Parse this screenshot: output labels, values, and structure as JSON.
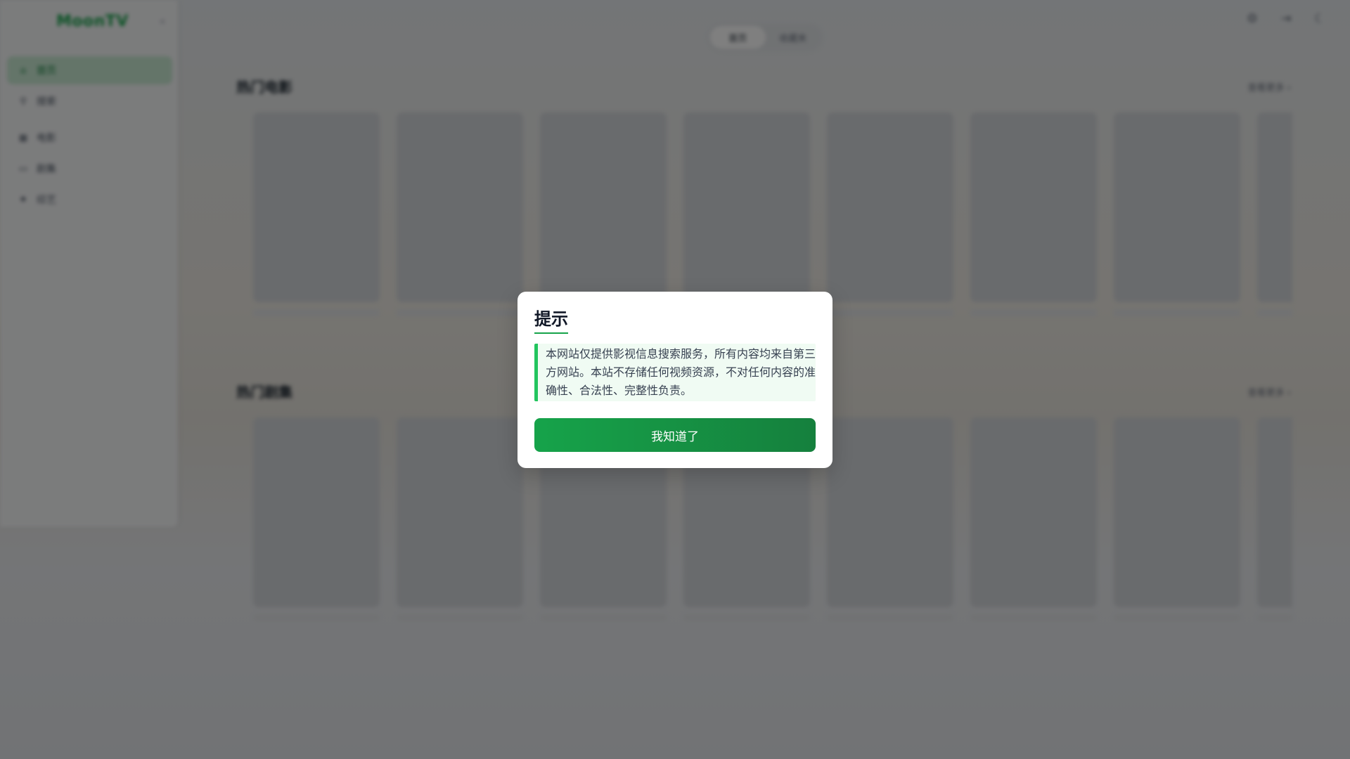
{
  "app": {
    "logo": "MoonTV",
    "collapse_icon": "collapse-icon"
  },
  "sidebar": {
    "items": [
      {
        "label": "首页",
        "icon": "home-icon",
        "active": true
      },
      {
        "label": "搜索",
        "icon": "search-icon"
      },
      {
        "label": "电影",
        "icon": "film-icon"
      },
      {
        "label": "剧集",
        "icon": "tv-icon"
      },
      {
        "label": "综艺",
        "icon": "star-icon"
      }
    ]
  },
  "topbar": {
    "tabs": [
      {
        "label": "首页",
        "active": true
      },
      {
        "label": "收藏夹"
      }
    ],
    "icons": [
      "settings-icon",
      "logout-icon",
      "theme-moon-icon"
    ]
  },
  "sections": [
    {
      "title": "热门电影",
      "more": "查看更多 ›"
    },
    {
      "title": "热门剧集",
      "more": "查看更多 ›"
    }
  ],
  "dialog": {
    "title": "提示",
    "message": "本网站仅提供影视信息搜索服务，所有内容均来自第三方网站。本站不存储任何视频资源，不对任何内容的准确性、合法性、完整性负责。",
    "confirm_label": "我知道了"
  },
  "colors": {
    "accent": "#16a34a",
    "accent_dark": "#15803d",
    "overlay": "rgba(0,0,0,0.5)"
  }
}
